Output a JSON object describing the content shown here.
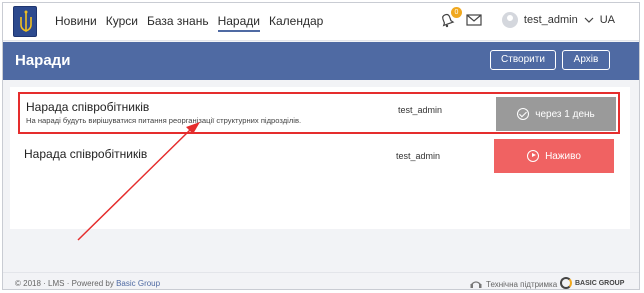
{
  "nav": {
    "items": [
      {
        "label": "Новини",
        "active": false
      },
      {
        "label": "Курси",
        "active": false
      },
      {
        "label": "База знань",
        "active": false
      },
      {
        "label": "Наради",
        "active": true
      },
      {
        "label": "Календар",
        "active": false
      }
    ],
    "notification_count": "0",
    "user_name": "test_admin",
    "language": "UA",
    "icons": [
      "coat-of-arms-logo",
      "bell-icon",
      "mail-icon",
      "avatar",
      "chevron-down-icon"
    ]
  },
  "header": {
    "title": "Наради",
    "create_label": "Створити",
    "archive_label": "Архів"
  },
  "meetings": [
    {
      "title": "Нарада співробітників",
      "description": "На нараді будуть вирішуватися питання реорганізації структурних підрозділів.",
      "author": "test_admin",
      "status": "через 1 день",
      "status_color": "#9a9a9a",
      "status_icon": "check-circle-icon",
      "highlighted": true
    },
    {
      "title": "Нарада співробітників",
      "description": "",
      "author": "test_admin",
      "status": "Наживо",
      "status_color": "#f06262",
      "status_icon": "play-circle-icon",
      "highlighted": false
    }
  ],
  "footer": {
    "copyright": "© 2018 · LMS · Powered by ",
    "powered_link": "Basic Group",
    "support_label": "Технічна підтримка",
    "brand_label": "BASIC GROUP"
  },
  "colors": {
    "accent": "#4f6aa3",
    "highlight_border": "#e52d2d",
    "annotation_arrow": "#e52d2d"
  }
}
